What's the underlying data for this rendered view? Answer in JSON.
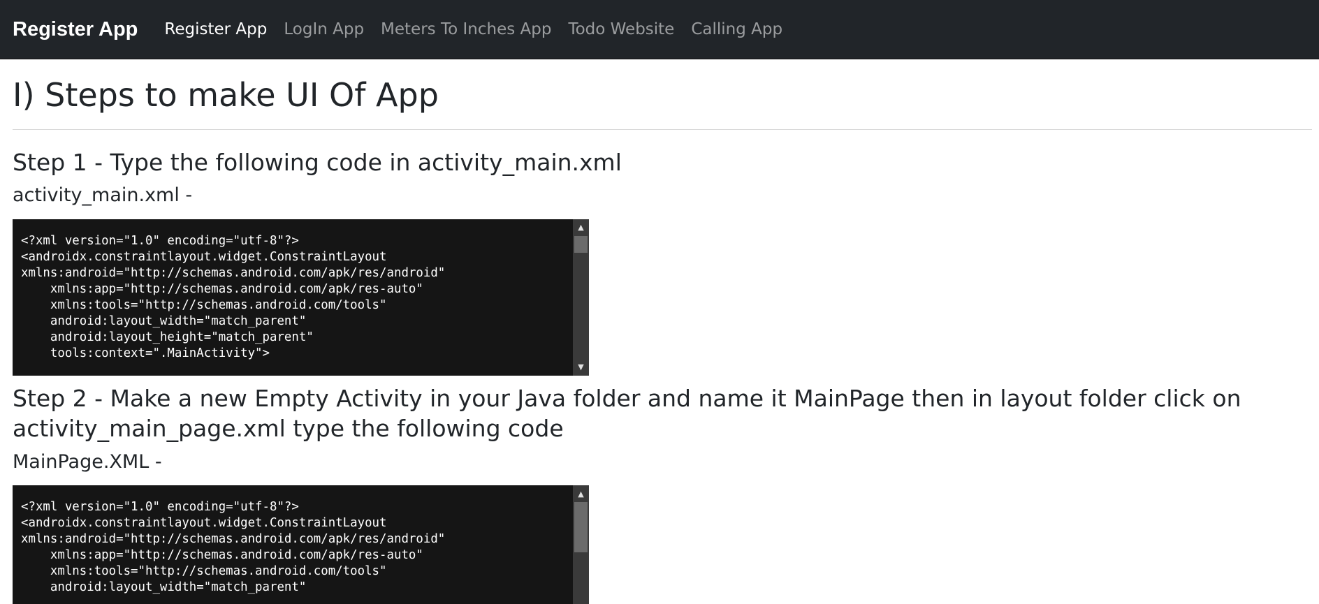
{
  "navbar": {
    "brand": "Register App",
    "links": [
      {
        "label": "Register App",
        "active": true
      },
      {
        "label": "LogIn App",
        "active": false
      },
      {
        "label": "Meters To Inches App",
        "active": false
      },
      {
        "label": "Todo Website",
        "active": false
      },
      {
        "label": "Calling App",
        "active": false
      }
    ]
  },
  "main": {
    "title": "I) Steps to make UI Of App",
    "steps": [
      {
        "title": "Step 1 - Type the following code in activity_main.xml",
        "file_label": "activity_main.xml -",
        "code": "<?xml version=\"1.0\" encoding=\"utf-8\"?>\n<androidx.constraintlayout.widget.ConstraintLayout\nxmlns:android=\"http://schemas.android.com/apk/res/android\"\n    xmlns:app=\"http://schemas.android.com/apk/res-auto\"\n    xmlns:tools=\"http://schemas.android.com/tools\"\n    android:layout_width=\"match_parent\"\n    android:layout_height=\"match_parent\"\n    tools:context=\".MainActivity\">"
      },
      {
        "title": "Step 2 - Make a new Empty Activity in your Java folder and name it MainPage then in layout folder click on activity_main_page.xml type the following code",
        "file_label": "MainPage.XML -",
        "code": "<?xml version=\"1.0\" encoding=\"utf-8\"?>\n<androidx.constraintlayout.widget.ConstraintLayout\nxmlns:android=\"http://schemas.android.com/apk/res/android\"\n    xmlns:app=\"http://schemas.android.com/apk/res-auto\"\n    xmlns:tools=\"http://schemas.android.com/tools\"\n    android:layout_width=\"match_parent\""
      }
    ]
  },
  "colors": {
    "navbar_bg": "#212529",
    "code_bg": "#151515",
    "text": "#212529"
  },
  "icons": {
    "scroll_up": "triangle-up-icon",
    "scroll_down": "triangle-down-icon"
  }
}
